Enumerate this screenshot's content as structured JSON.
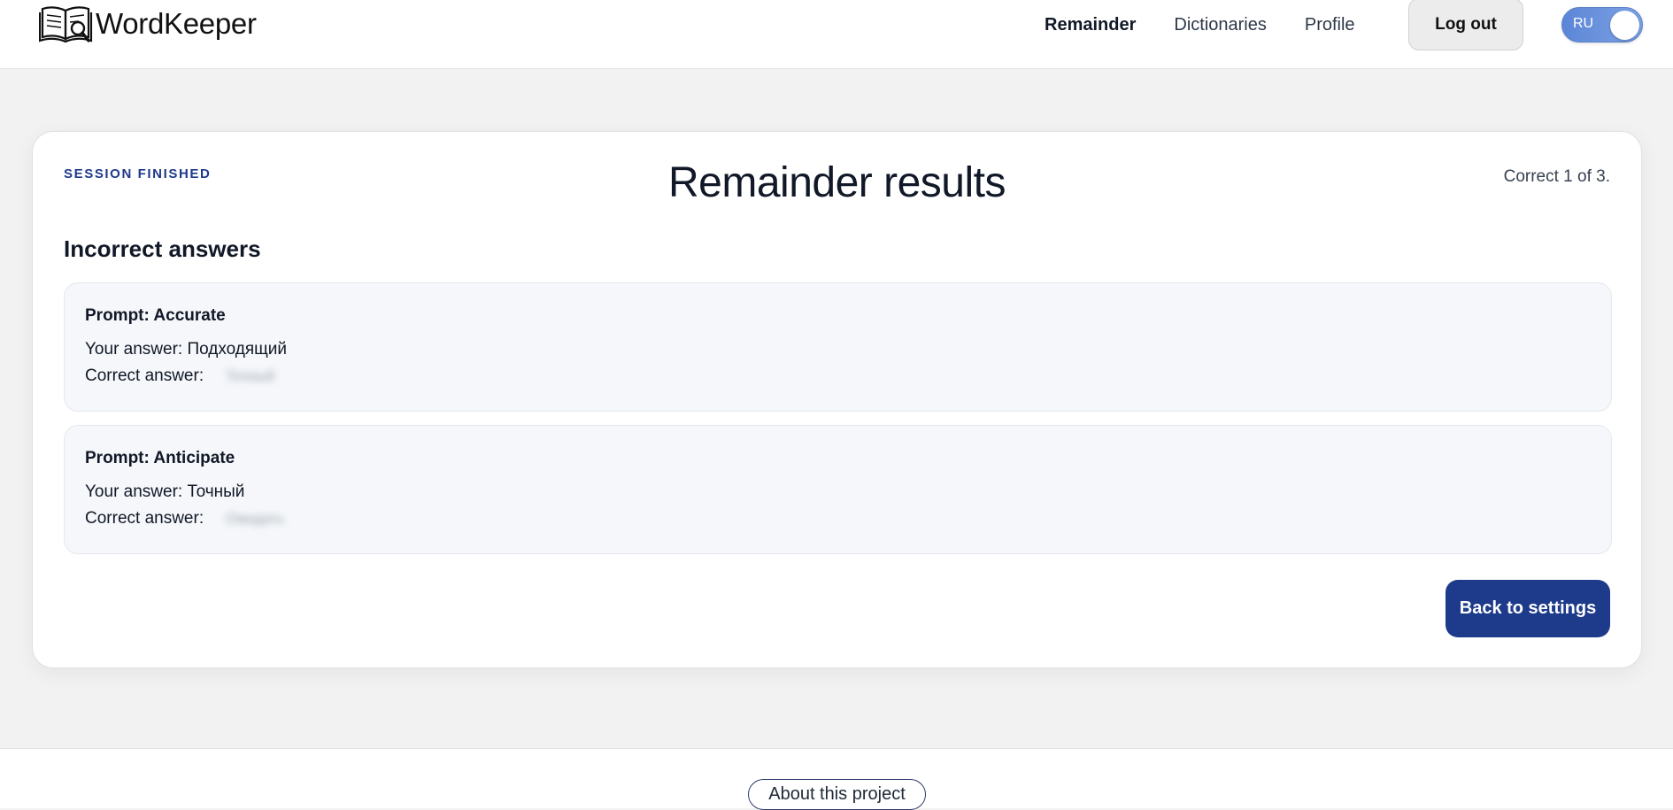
{
  "header": {
    "brand": "WordKeeper",
    "logo_icon": "book-magnifier-icon",
    "nav": [
      {
        "label": "Remainder",
        "active": true
      },
      {
        "label": "Dictionaries",
        "active": false
      },
      {
        "label": "Profile",
        "active": false
      }
    ],
    "logout_label": "Log out",
    "language": {
      "label": "RU",
      "enabled": true,
      "accent": "#5b85d6"
    }
  },
  "results": {
    "eyebrow": "SESSION FINISHED",
    "title": "Remainder results",
    "score_text": "Correct 1 of 3.",
    "section_title": "Incorrect answers",
    "items": [
      {
        "prompt": "Prompt: Accurate",
        "your_answer": "Your answer: Подходящий",
        "correct_label": "Correct answer:",
        "correct_value": "Точный"
      },
      {
        "prompt": "Prompt: Anticipate",
        "your_answer": "Your answer: Точный",
        "correct_label": "Correct answer:",
        "correct_value": "Ожидать"
      }
    ],
    "back_label": "Back to settings",
    "accent": "#1e3a8a"
  },
  "footer": {
    "about_label": "About this project"
  }
}
